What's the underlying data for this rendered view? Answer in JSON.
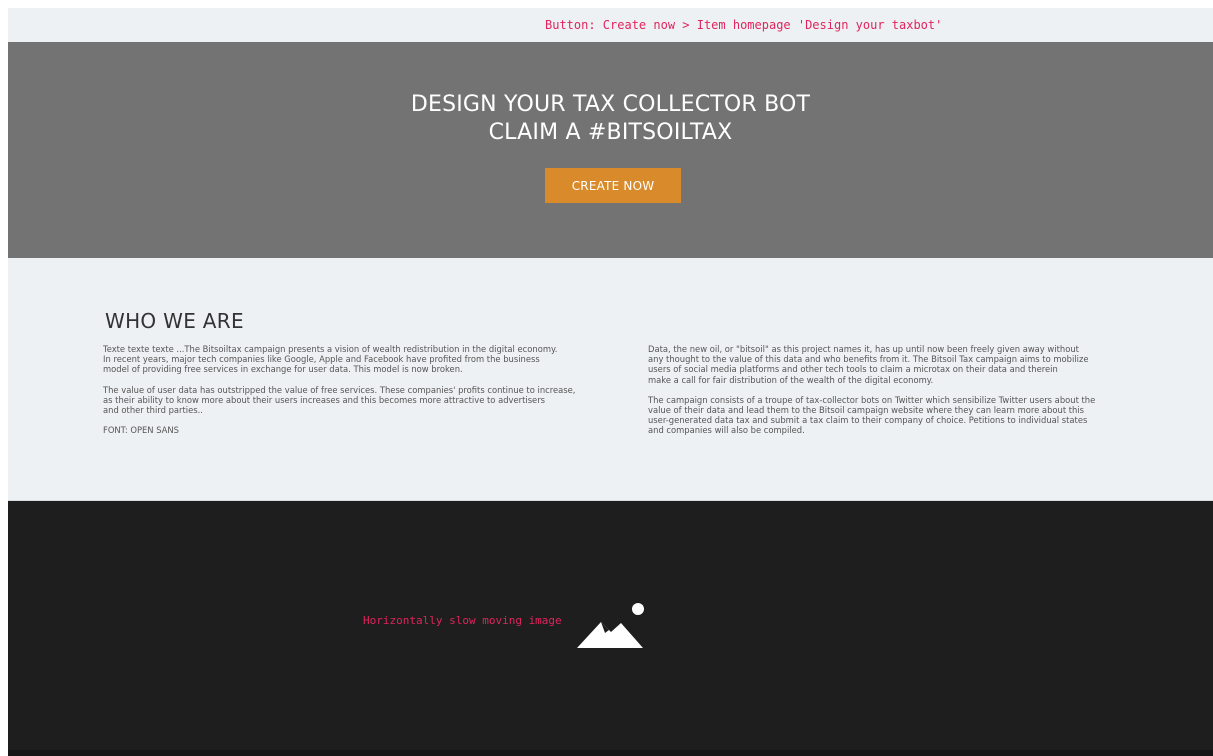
{
  "annotations": {
    "top": "Button: Create now > Item homepage 'Design your taxbot'",
    "media": "Horizontally slow moving image"
  },
  "hero": {
    "title_line_1": "DESIGN YOUR TAX COLLECTOR BOT",
    "title_line_2": "CLAIM A #BITSOILTAX",
    "cta_label": "CREATE NOW",
    "background_color": "#737373",
    "cta_color": "#d98b2b"
  },
  "about": {
    "heading": "WHO WE ARE",
    "left_column": {
      "p1_lines": [
        "Texte texte texte ...The Bitsoiltax campaign presents a vision of wealth redistribution in the digital economy.",
        "In recent years, major tech companies like Google, Apple and Facebook have profited from the business",
        "model of providing free services in exchange for user data. This model is now broken."
      ],
      "p2_lines": [
        "The value of user data has outstripped the value of free services. These companies' profits continue to increase,",
        "as their ability to know more about their users increases and this becomes more attractive to advertisers",
        "and other third parties.."
      ],
      "p3": "FONT: OPEN SANS"
    },
    "right_column": {
      "p1_lines": [
        "Data, the new oil, or \"bitsoil\" as this project names it, has up until now been freely given away without",
        "any thought to the value of this data and who benefits from it. The Bitsoil Tax campaign aims to mobilize",
        "users of social media platforms and other tech tools to claim a microtax on their data and therein",
        "make a call for fair distribution of the wealth of the digital economy."
      ],
      "p2_lines": [
        "The campaign consists of a troupe of tax-collector bots on Twitter which sensibilize Twitter users about the",
        "value of their data and lead them to the Bitsoil campaign website where they can learn more about this",
        "user-generated data tax and submit a tax claim to their company of choice. Petitions to individual states",
        "and companies will also be compiled."
      ]
    }
  },
  "media": {
    "icon": "image-placeholder-icon",
    "background_color": "#1e1e1e"
  },
  "colors": {
    "page_background": "#eef1f3",
    "annotation": "#e0245e"
  }
}
